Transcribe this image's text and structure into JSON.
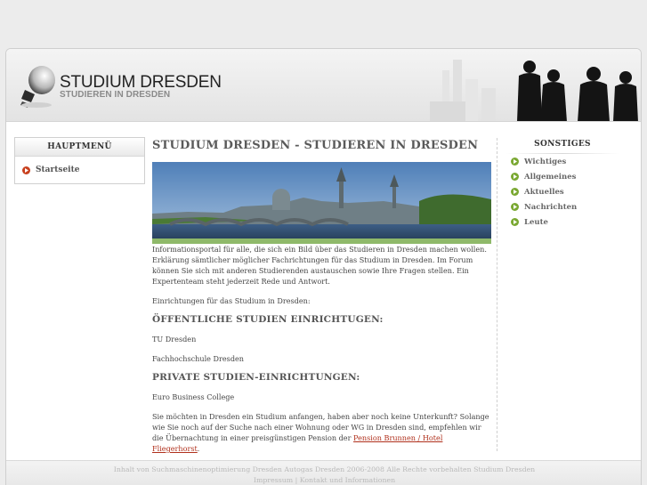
{
  "colors": {
    "page_bg": "#ececec",
    "accent_bullet": "#7aa832",
    "red_bullet": "#c8401e",
    "link": "#b0301c"
  },
  "header": {
    "title": "STUDIUM DRESDEN",
    "subtitle": "STUDIEREN IN DRESDEN",
    "logo_icon": "lightbulb-icon",
    "decor_icon": "people-silhouettes"
  },
  "left_menu": {
    "heading": "HAUPTMENÜ",
    "items": [
      {
        "label": "Startseite",
        "icon": "arrow-bullet-icon"
      }
    ]
  },
  "main": {
    "title": "STUDIUM DRESDEN - STUDIEREN IN DRESDEN",
    "intro": "Informationsportal für alle, die sich ein Bild über das Studieren in Dresden machen wollen. Erklärung sämtlicher möglicher Fachrichtungen für das Studium in Dresden. Im Forum können Sie sich mit anderen Studierenden austauschen sowie Ihre Fragen stellen. Ein Expertenteam steht jederzeit Rede und Antwort.",
    "einrichtungen": "Einrichtungen für das Studium in Dresden:",
    "public_heading": "ÖFFENTLICHE STUDIEN EINRICHTUGEN:",
    "public_items": [
      "TU Dresden",
      "Fachhochschule Dresden"
    ],
    "private_heading": "PRIVATE STUDIEN-EINRICHTUNGEN:",
    "private_items": [
      "Euro Business College"
    ],
    "closing_text": "Sie möchten in Dresden ein Studium anfangen, haben aber noch keine Unterkunft? Solange wie Sie noch auf der Suche nach einer Wohnung oder WG in Dresden sind, empfehlen wir die Übernachtung in einer preisgünstigen Pension der ",
    "closing_link": "Pension Brunnen / Hotel Fliegerhorst",
    "closing_end": "."
  },
  "right_menu": {
    "heading": "SONSTIGES",
    "items": [
      {
        "label": "Wichtiges"
      },
      {
        "label": "Allgemeines"
      },
      {
        "label": "Aktuelles"
      },
      {
        "label": "Nachrichten"
      },
      {
        "label": "Leute"
      }
    ]
  },
  "footer": {
    "line1": "Inhalt von Suchmaschinenoptimierung Dresden Autogas Dresden 2006-2008 Alle Rechte vorbehalten Studium Dresden",
    "impressum": "Impressum",
    "separator": " | ",
    "kontakt": "Kontakt und Informationen"
  }
}
